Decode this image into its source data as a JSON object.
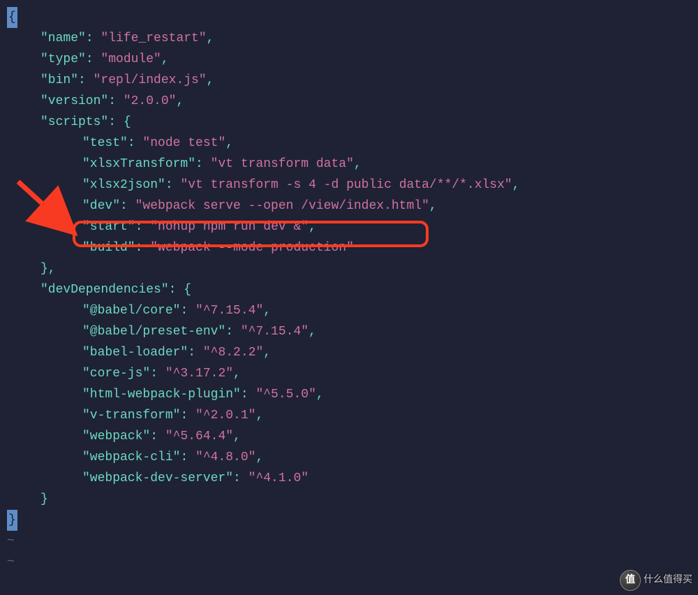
{
  "code": {
    "open_brace": "{",
    "name_key": "\"name\"",
    "name_val": "\"life_restart\"",
    "type_key": "\"type\"",
    "type_val": "\"module\"",
    "bin_key": "\"bin\"",
    "bin_val": "\"repl/index.js\"",
    "version_key": "\"version\"",
    "version_val": "\"2.0.0\"",
    "scripts_key": "\"scripts\"",
    "scripts_open": ": {",
    "test_key": "\"test\"",
    "test_val": "\"node test\"",
    "xlsxTransform_key": "\"xlsxTransform\"",
    "xlsxTransform_val": "\"vt transform data\"",
    "xlsx2json_key": "\"xlsx2json\"",
    "xlsx2json_val": "\"vt transform -s 4 -d public data/**/*.xlsx\"",
    "dev_key": "\"dev\"",
    "dev_val": "\"webpack serve --open /view/index.html\"",
    "start_key": "\"start\"",
    "start_val": "\"nohup npm run dev &\"",
    "build_key": "\"build\"",
    "build_val": "\"webpack --mode production\"",
    "scripts_close": "},",
    "devDeps_key": "\"devDependencies\"",
    "devDeps_open": ": {",
    "babel_core_key": "\"@babel/core\"",
    "babel_core_val": "\"^7.15.4\"",
    "babel_preset_key": "\"@babel/preset-env\"",
    "babel_preset_val": "\"^7.15.4\"",
    "babel_loader_key": "\"babel-loader\"",
    "babel_loader_val": "\"^8.2.2\"",
    "corejs_key": "\"core-js\"",
    "corejs_val": "\"^3.17.2\"",
    "htmlwp_key": "\"html-webpack-plugin\"",
    "htmlwp_val": "\"^5.5.0\"",
    "vtransform_key": "\"v-transform\"",
    "vtransform_val": "\"^2.0.1\"",
    "webpack_key": "\"webpack\"",
    "webpack_val": "\"^5.64.4\"",
    "webpackcli_key": "\"webpack-cli\"",
    "webpackcli_val": "\"^4.8.0\"",
    "webpackdev_key": "\"webpack-dev-server\"",
    "webpackdev_val": "\"^4.1.0\"",
    "devDeps_close": "}",
    "close_brace": "}",
    "tilde": "~"
  },
  "watermark": {
    "badge": "值",
    "text": "什么值得买",
    "faint": ""
  }
}
